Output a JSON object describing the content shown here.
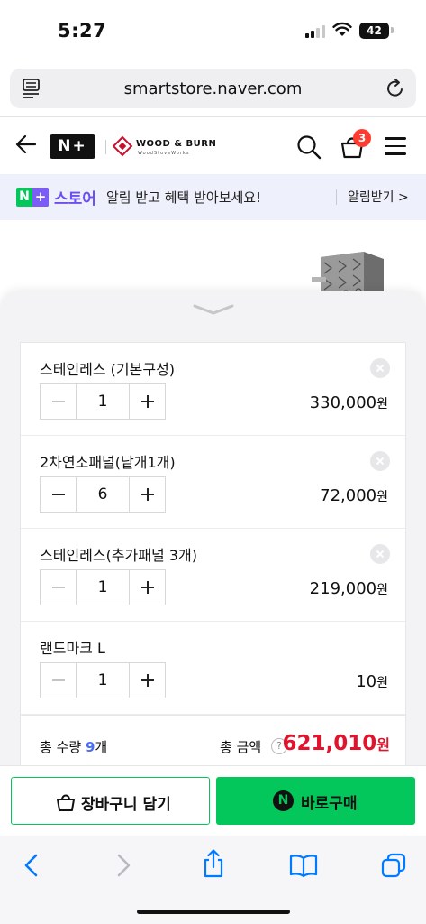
{
  "status_bar": {
    "time": "5:27",
    "battery": "42"
  },
  "browser": {
    "url": "smartstore.naver.com"
  },
  "header": {
    "brand_nplus": "N+",
    "store_logo_name": "WOOD & BURN",
    "store_logo_sub": "WoodStoveWorks",
    "cart_count": "3"
  },
  "promo": {
    "badge_n": "N",
    "badge_plus": "+",
    "store_word": "스토어",
    "message": "알림 받고 혜택 받아보세요!",
    "cta": "알림받기 >"
  },
  "options": [
    {
      "name": "스테인레스 (기본구성)",
      "quantity": "1",
      "price": "330,000",
      "minus_disabled": true
    },
    {
      "name": "2차연소패널(낱개1개)",
      "quantity": "6",
      "price": "72,000",
      "minus_disabled": false
    },
    {
      "name": "스테인레스(추가패널 3개)",
      "quantity": "1",
      "price": "219,000",
      "minus_disabled": true
    },
    {
      "name": "랜드마크 L",
      "quantity": "1",
      "price": "10",
      "minus_disabled": true
    }
  ],
  "currency": "원",
  "summary": {
    "quantity_label": "총 수량",
    "quantity_value": "9",
    "quantity_unit": "개",
    "amount_label": "총 금액",
    "help_symbol": "?",
    "amount_value": "621,010"
  },
  "buttons": {
    "add_to_cart": "장바구니 담기",
    "buy_now_icon": "N",
    "buy_now": "바로구매"
  },
  "colors": {
    "naver_green": "#03c75a",
    "price_red": "#e2142d",
    "badge_red": "#ff3b30",
    "store_purple": "#6b4ff0",
    "ios_blue": "#007aff"
  }
}
